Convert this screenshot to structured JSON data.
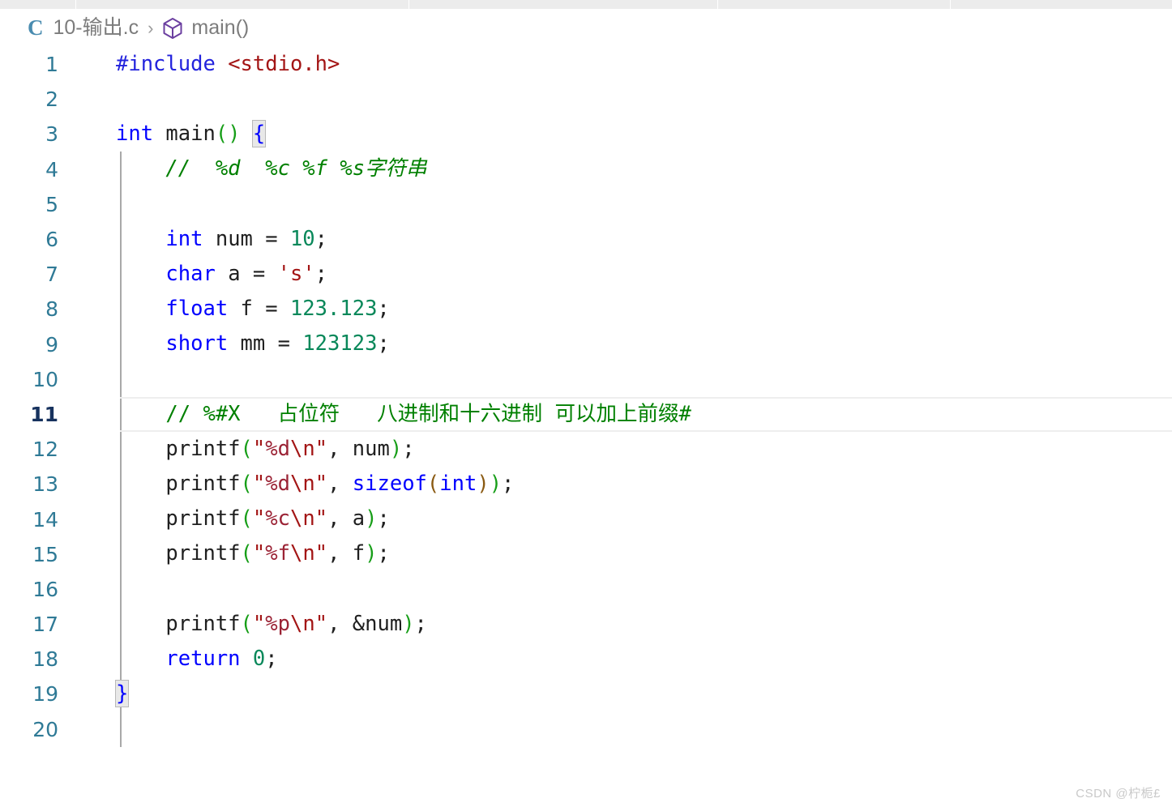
{
  "window": {
    "background": "#ffffff",
    "tabstrip": {
      "background": "#ececec",
      "divider_positions": [
        93,
        504,
        885,
        1172
      ]
    }
  },
  "breadcrumb": {
    "file_icon_letter": "C",
    "file_icon_color": "#4a8cb0",
    "file_name": "10-输出.c",
    "separator": "›",
    "symbol_icon": "cube-icon",
    "symbol_icon_color": "#6b3fa0",
    "symbol_name": "main()"
  },
  "editor": {
    "line_number_color": "#2f7a96",
    "active_line_number_color": "#17325e",
    "active_line": 11,
    "indent_guide_color": "#a9a9a9",
    "lines": [
      {
        "n": "1",
        "text": "#include <stdio.h>"
      },
      {
        "n": "2",
        "text": ""
      },
      {
        "n": "3",
        "text": "int main() {"
      },
      {
        "n": "4",
        "text": "    //  %d  %c %f %s字符串"
      },
      {
        "n": "5",
        "text": ""
      },
      {
        "n": "6",
        "text": "    int num = 10;"
      },
      {
        "n": "7",
        "text": "    char a = 's';"
      },
      {
        "n": "8",
        "text": "    float f = 123.123;"
      },
      {
        "n": "9",
        "text": "    short mm = 123123;"
      },
      {
        "n": "10",
        "text": ""
      },
      {
        "n": "11",
        "text": "    // %#X   占位符   八进制和十六进制 可以加上前缀#"
      },
      {
        "n": "12",
        "text": "    printf(\"%d\\n\", num);"
      },
      {
        "n": "13",
        "text": "    printf(\"%d\\n\", sizeof(int));"
      },
      {
        "n": "14",
        "text": "    printf(\"%c\\n\", a);"
      },
      {
        "n": "15",
        "text": "    printf(\"%f\\n\", f);"
      },
      {
        "n": "16",
        "text": ""
      },
      {
        "n": "17",
        "text": "    printf(\"%p\\n\", &num);"
      },
      {
        "n": "18",
        "text": "    return 0;"
      },
      {
        "n": "19",
        "text": "}"
      },
      {
        "n": "20",
        "text": ""
      }
    ],
    "tokens": {
      "line1": {
        "pp": "#include",
        "space": " ",
        "inc": "<stdio.h>"
      },
      "line3": {
        "kw": "int",
        "name": " main",
        "parens": "()",
        "space": " ",
        "brace": "{"
      },
      "line4": {
        "comment": "//  %d  %c %f %s字符串"
      },
      "line6": {
        "kw": "int",
        "name": " num = ",
        "num": "10",
        "semi": ";"
      },
      "line7": {
        "kw": "char",
        "name": " a = ",
        "str": "'s'",
        "semi": ";"
      },
      "line8": {
        "kw": "float",
        "name": " f = ",
        "num": "123.123",
        "semi": ";"
      },
      "line9": {
        "kw": "short",
        "name": " mm = ",
        "num": "123123",
        "semi": ";"
      },
      "line11": {
        "comment": "// %#X   占位符   八进制和十六进制 可以加上前缀#"
      },
      "line12": {
        "fn": "printf",
        "open": "(",
        "str_open": "\"",
        "fmt": "%d",
        "esc": "\\n",
        "str_close": "\"",
        "arg": ", num",
        "close": ")",
        "semi": ";"
      },
      "line13": {
        "fn": "printf",
        "open": "(",
        "str_open": "\"",
        "fmt": "%d",
        "esc": "\\n",
        "str_close": "\"",
        "comma": ", ",
        "kw_sizeof": "sizeof",
        "inner_open": "(",
        "kw_int": "int",
        "inner_close": ")",
        "close": ")",
        "semi": ";"
      },
      "line14": {
        "fn": "printf",
        "open": "(",
        "str_open": "\"",
        "fmt": "%c",
        "esc": "\\n",
        "str_close": "\"",
        "arg": ", a",
        "close": ")",
        "semi": ";"
      },
      "line15": {
        "fn": "printf",
        "open": "(",
        "str_open": "\"",
        "fmt": "%f",
        "esc": "\\n",
        "str_close": "\"",
        "arg": ", f",
        "close": ")",
        "semi": ";"
      },
      "line17": {
        "fn": "printf",
        "open": "(",
        "str_open": "\"",
        "fmt": "%p",
        "esc": "\\n",
        "str_close": "\"",
        "arg": ", &num",
        "close": ")",
        "semi": ";"
      },
      "line18": {
        "kw": "return",
        "space": " ",
        "num": "0",
        "semi": ";"
      },
      "line19": {
        "brace": "}"
      }
    },
    "colors": {
      "keyword": "#0000ff",
      "preprocessor": "#2323dd",
      "include_path": "#a31515",
      "number": "#09885a",
      "string": "#a31515",
      "format_spec": "#9b2335",
      "comment": "#008000",
      "bracket_level1": "#179e18",
      "bracket_level2": "#8a5a12",
      "plain": "#1f1f1f"
    }
  },
  "watermark": {
    "text": "CSDN @柠栀£"
  }
}
